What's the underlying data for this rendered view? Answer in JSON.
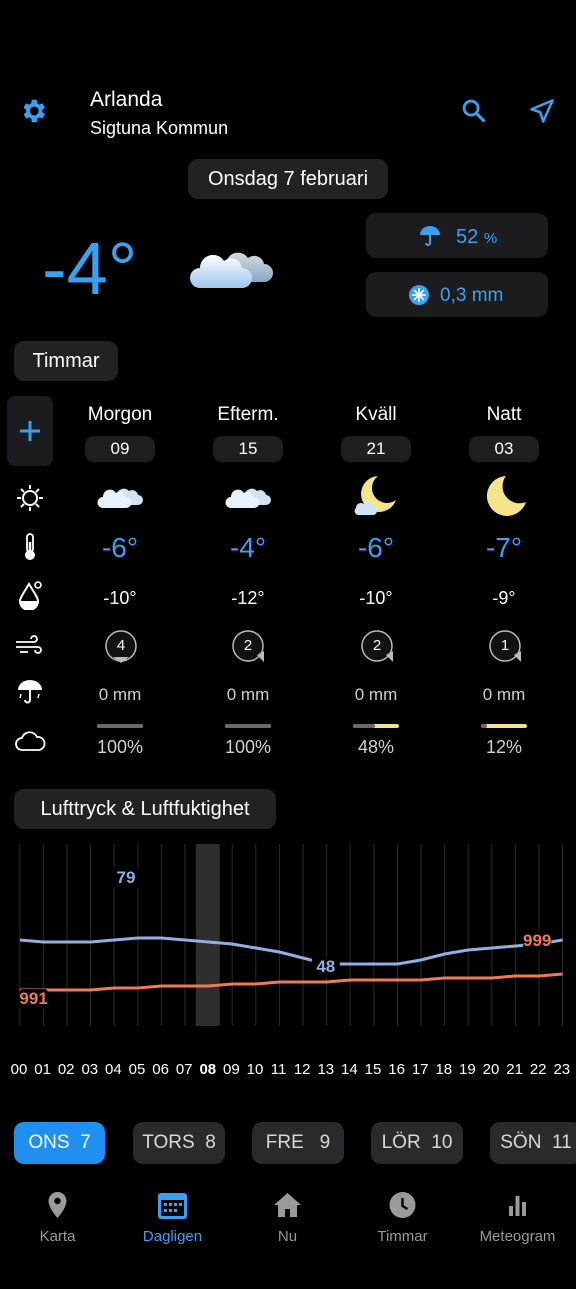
{
  "header": {
    "location": "Arlanda",
    "municipality": "Sigtuna Kommun",
    "date": "Onsdag 7 februari"
  },
  "current": {
    "temp": "-4°",
    "precip_chance": "52",
    "precip_unit": "%",
    "precip_amount": "0,3 mm"
  },
  "hours_section": "Timmar",
  "periods": [
    {
      "name": "Morgon",
      "time": "09",
      "temp": "-6°",
      "feels": "-10°",
      "wind": "4",
      "precip": "0 mm",
      "cloud": "100%",
      "cloud_fraction": 1.0,
      "icon": "cloud-icon"
    },
    {
      "name": "Efterm.",
      "time": "15",
      "temp": "-4°",
      "feels": "-12°",
      "wind": "2",
      "precip": "0 mm",
      "cloud": "100%",
      "cloud_fraction": 1.0,
      "icon": "cloud-icon"
    },
    {
      "name": "Kväll",
      "time": "21",
      "temp": "-6°",
      "feels": "-10°",
      "wind": "2",
      "precip": "0 mm",
      "cloud": "48%",
      "cloud_fraction": 0.48,
      "icon": "moon-cloud-icon"
    },
    {
      "name": "Natt",
      "time": "03",
      "temp": "-7°",
      "feels": "-9°",
      "wind": "1",
      "precip": "0 mm",
      "cloud": "12%",
      "cloud_fraction": 0.12,
      "icon": "moon-icon"
    }
  ],
  "chart_section": "Lufttryck & Luftfuktighet",
  "chart_data": {
    "type": "line",
    "x": [
      "00",
      "01",
      "02",
      "03",
      "04",
      "05",
      "06",
      "07",
      "08",
      "09",
      "10",
      "11",
      "12",
      "13",
      "14",
      "15",
      "16",
      "17",
      "18",
      "19",
      "20",
      "21",
      "22",
      "23"
    ],
    "highlight_x": "08",
    "series": [
      {
        "values": [
          80,
          79,
          79,
          79,
          80,
          81,
          81,
          80,
          79,
          78,
          76,
          74,
          71,
          68,
          68,
          68,
          68,
          70,
          73,
          75,
          76,
          77,
          78,
          80
        ],
        "color": "#8fb0e0"
      },
      {
        "values": [
          991,
          991,
          991,
          991,
          992,
          992,
          993,
          993,
          993,
          994,
          994,
          995,
          995,
          995,
          996,
          996,
          996,
          996,
          997,
          997,
          997,
          998,
          998,
          999
        ],
        "color": "#f07a55"
      }
    ],
    "labels": [
      "79",
      "48",
      "991",
      "999"
    ]
  },
  "days": [
    {
      "label": "ONS",
      "num": "7",
      "active": true
    },
    {
      "label": "TORS",
      "num": "8"
    },
    {
      "label": "FRE",
      "num": "9"
    },
    {
      "label": "LÖR",
      "num": "10"
    },
    {
      "label": "SÖN",
      "num": "11"
    }
  ],
  "nav": [
    "Karta",
    "Dagligen",
    "Nu",
    "Timmar",
    "Meteogram"
  ],
  "colors": {
    "accent": "#3aa0f0",
    "pressure": "#f07a55",
    "humidity": "#8fb0e0",
    "sun": "#f4e48a"
  }
}
